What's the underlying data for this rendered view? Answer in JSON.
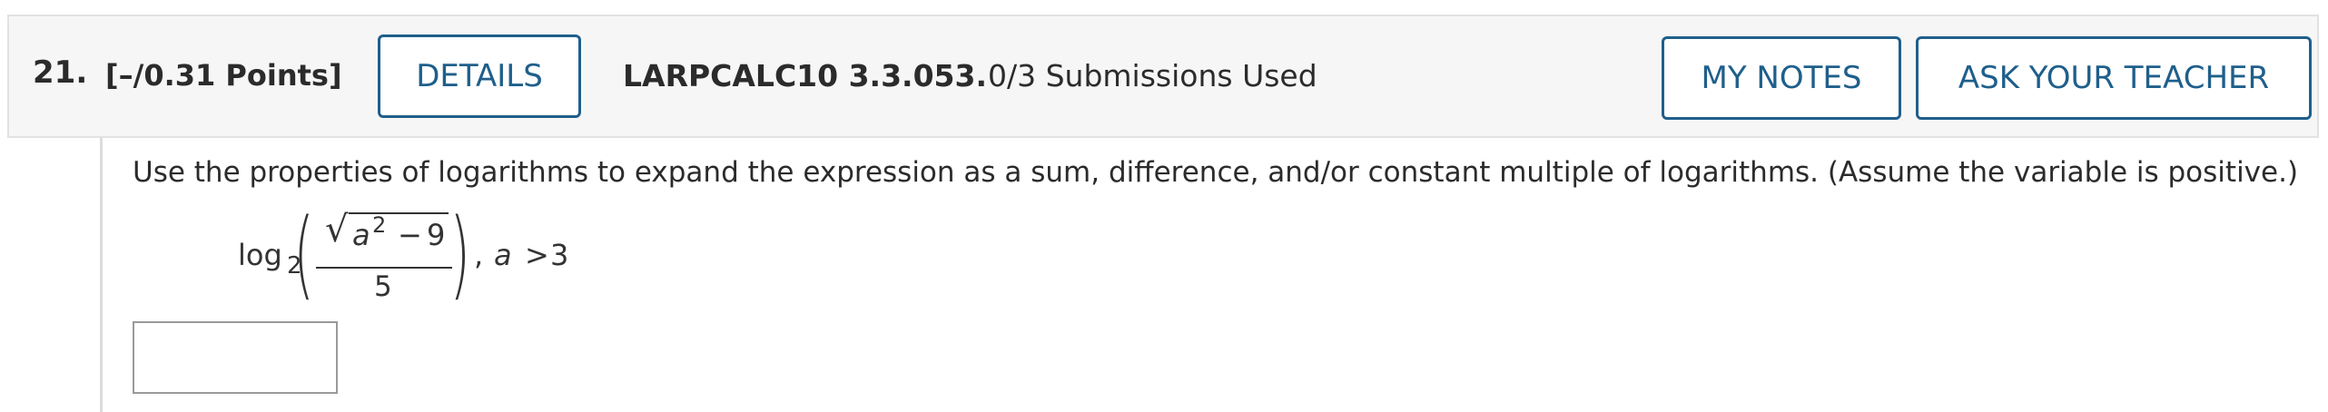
{
  "question": {
    "number": "21.",
    "points": "[–/0.31 Points]",
    "details_label": "DETAILS",
    "code": "LARPCALC10 3.3.053.",
    "submissions": "0/3 Submissions Used",
    "my_notes_label": "MY NOTES",
    "ask_teacher_label": "ASK YOUR TEACHER"
  },
  "body": {
    "prompt": "Use the properties of logarithms to expand the expression as a sum, difference, and/or constant multiple of logarithms. (Assume the variable is positive.)",
    "expression": {
      "log": "log",
      "base": "2",
      "sqrt_var": "a",
      "exponent": "2",
      "minus": "−",
      "constant": "9",
      "denominator": "5",
      "separator": ",",
      "condition_var": "a",
      "condition_op": ">",
      "condition_value": "3"
    },
    "answer": {
      "value": "",
      "placeholder": ""
    }
  },
  "colors": {
    "accent": "#1f5f8b",
    "highlight_red": "#d2231f",
    "header_bg": "#f6f6f6"
  }
}
